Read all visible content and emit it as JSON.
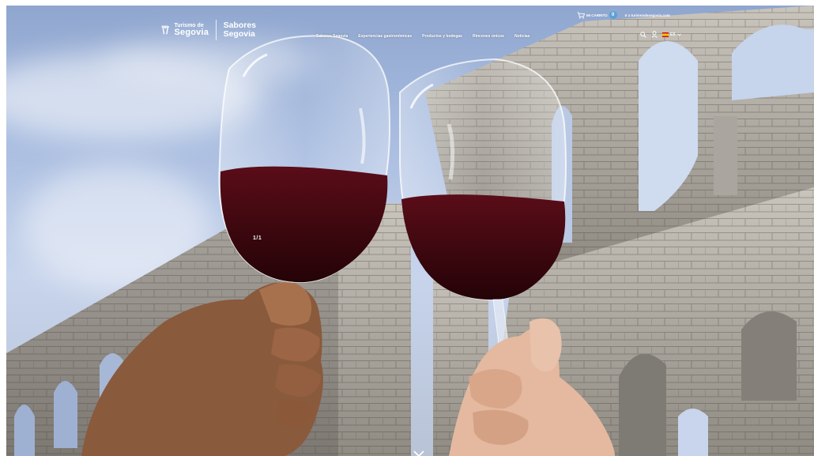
{
  "header": {
    "logo": {
      "small": "Turismo",
      "connector": "de",
      "big": "Segovia",
      "brand_line1": "Sabores",
      "brand_line2": "Segovia"
    },
    "nav": [
      "Sabores Segovia",
      "Experiencias gastronómicas",
      "Productos y bodegas",
      "Rincones únicos",
      "Noticias"
    ],
    "cart": {
      "label": "MI CARRITO",
      "count": "0"
    },
    "goto_link": "Ir a turismodesegovia.com",
    "language": "ES"
  },
  "hero": {
    "slide_counter": "1/1"
  },
  "colors": {
    "accent": "#5aa1d8",
    "wine": "#3a0510",
    "stone": "#b8b5ae"
  },
  "icons": [
    "cart-icon",
    "search-icon",
    "user-icon",
    "flag-icon",
    "chevron-down-icon",
    "scroll-down-chevron-icon"
  ]
}
